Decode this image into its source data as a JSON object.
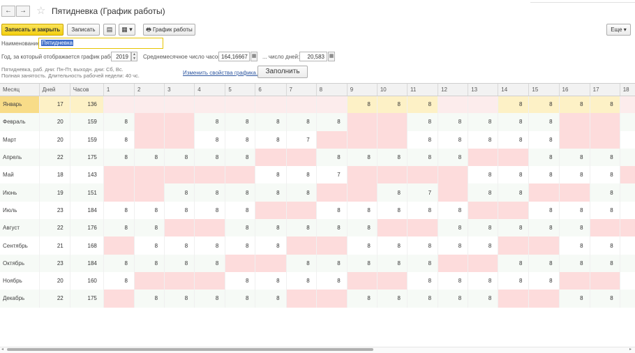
{
  "window": {
    "title": "Пятидневка (График работы)",
    "back_icon": "←",
    "forward_icon": "→",
    "favorite_icon": "☆"
  },
  "toolbar": {
    "save_close_label": "Записать и закрыть",
    "save_label": "Записать",
    "document_icon": "▤",
    "print_menu_icon": "▦ ▾",
    "schedule_print_icon": "🖶",
    "schedule_print_label": "График работы",
    "more_label": "Еще ▾"
  },
  "form": {
    "name_label": "Наименование:",
    "name_value": "Пятидневка",
    "year_label": "Год, за который отображается график работы:",
    "year_value": "2019",
    "avg_hours_label": "Среднемесячное число часов:",
    "avg_hours_value": "164,16667",
    "days_label": "... число дней:",
    "days_value": "20,583",
    "info_line1": "Пятидневка, раб. дни: Пн-Пт, выходн. дни: Сб, Вс.",
    "info_line2": "Полная занятость. Длительность рабочей недели: 40 чс.",
    "change_link": "Изменить свойства графика...",
    "fill_button": "Заполнить"
  },
  "table": {
    "headers": {
      "month": "Месяц",
      "days": "Дней",
      "hours": "Часов",
      "d1": "1",
      "d2": "2",
      "d3": "3",
      "d4": "4",
      "d5": "5",
      "d6": "6",
      "d7": "7",
      "d8": "8",
      "d9": "9",
      "d10": "10",
      "d11": "11",
      "d12": "12",
      "d13": "13",
      "d14": "14",
      "d15": "15",
      "d16": "16",
      "d17": "17",
      "d18": "18"
    },
    "rows": [
      {
        "month": "Январь",
        "days": "17",
        "hours": "136",
        "cells": [
          "",
          "",
          "",
          "",
          "",
          "",
          "",
          "",
          "8",
          "8",
          "8",
          "",
          "",
          "8",
          "8",
          "8",
          "8",
          ""
        ]
      },
      {
        "month": "Февраль",
        "days": "20",
        "hours": "159",
        "cells": [
          "8",
          "",
          "",
          "8",
          "8",
          "8",
          "8",
          "8",
          "",
          "",
          "8",
          "8",
          "8",
          "8",
          "8",
          "",
          "",
          "8"
        ]
      },
      {
        "month": "Март",
        "days": "20",
        "hours": "159",
        "cells": [
          "8",
          "",
          "",
          "8",
          "8",
          "8",
          "7",
          "",
          "",
          "",
          "8",
          "8",
          "8",
          "8",
          "8",
          "",
          "",
          "8"
        ]
      },
      {
        "month": "Апрель",
        "days": "22",
        "hours": "175",
        "cells": [
          "8",
          "8",
          "8",
          "8",
          "8",
          "",
          "",
          "8",
          "8",
          "8",
          "8",
          "8",
          "",
          "",
          "8",
          "8",
          "8",
          "8"
        ]
      },
      {
        "month": "Май",
        "days": "18",
        "hours": "143",
        "cells": [
          "",
          "",
          "",
          "",
          "",
          "8",
          "8",
          "7",
          "",
          "",
          "",
          "",
          "8",
          "8",
          "8",
          "8",
          "8",
          ""
        ]
      },
      {
        "month": "Июнь",
        "days": "19",
        "hours": "151",
        "cells": [
          "",
          "",
          "8",
          "8",
          "8",
          "8",
          "8",
          "",
          "",
          "8",
          "7",
          "",
          "8",
          "8",
          "",
          "",
          "8",
          "8"
        ]
      },
      {
        "month": "Июль",
        "days": "23",
        "hours": "184",
        "cells": [
          "8",
          "8",
          "8",
          "8",
          "8",
          "",
          "",
          "8",
          "8",
          "8",
          "8",
          "8",
          "",
          "",
          "8",
          "8",
          "8",
          "8"
        ]
      },
      {
        "month": "Август",
        "days": "22",
        "hours": "176",
        "cells": [
          "8",
          "8",
          "",
          "",
          "8",
          "8",
          "8",
          "8",
          "8",
          "",
          "",
          "8",
          "8",
          "8",
          "8",
          "8",
          "",
          ""
        ]
      },
      {
        "month": "Сентябрь",
        "days": "21",
        "hours": "168",
        "cells": [
          "",
          "8",
          "8",
          "8",
          "8",
          "8",
          "",
          "",
          "8",
          "8",
          "8",
          "8",
          "8",
          "",
          "",
          "8",
          "8",
          "8"
        ]
      },
      {
        "month": "Октябрь",
        "days": "23",
        "hours": "184",
        "cells": [
          "8",
          "8",
          "8",
          "8",
          "",
          "",
          "8",
          "8",
          "8",
          "8",
          "8",
          "",
          "",
          "8",
          "8",
          "8",
          "8",
          "8"
        ]
      },
      {
        "month": "Ноябрь",
        "days": "20",
        "hours": "160",
        "cells": [
          "8",
          "",
          "",
          "",
          "8",
          "8",
          "8",
          "8",
          "",
          "",
          "8",
          "8",
          "8",
          "8",
          "8",
          "",
          "",
          "8"
        ]
      },
      {
        "month": "Декабрь",
        "days": "22",
        "hours": "175",
        "cells": [
          "",
          "8",
          "8",
          "8",
          "8",
          "8",
          "",
          "",
          "8",
          "8",
          "8",
          "8",
          "8",
          "",
          "",
          "8",
          "8",
          "8"
        ]
      }
    ],
    "off_days": [
      [
        1,
        2,
        3,
        4,
        5,
        6,
        7,
        8,
        12,
        13,
        18
      ],
      [
        2,
        3,
        9,
        10,
        16,
        17
      ],
      [
        2,
        3,
        8,
        9,
        10,
        16,
        17
      ],
      [
        6,
        7,
        13,
        14
      ],
      [
        1,
        2,
        3,
        4,
        5,
        9,
        10,
        11,
        12,
        18
      ],
      [
        1,
        2,
        8,
        9,
        12,
        15,
        16
      ],
      [
        6,
        7,
        13,
        14
      ],
      [
        3,
        4,
        10,
        11,
        17,
        18
      ],
      [
        1,
        7,
        8,
        14,
        15
      ],
      [
        5,
        6,
        12,
        13
      ],
      [
        2,
        3,
        4,
        9,
        10,
        16,
        17
      ],
      [
        1,
        7,
        8,
        14,
        15
      ]
    ],
    "selected_row": 0,
    "colors": {
      "off_day": "#fddcdc",
      "selected_row": "#fdf1c6",
      "selected_cell": "#f8dc88",
      "alt_row": "#f6faf6"
    }
  }
}
